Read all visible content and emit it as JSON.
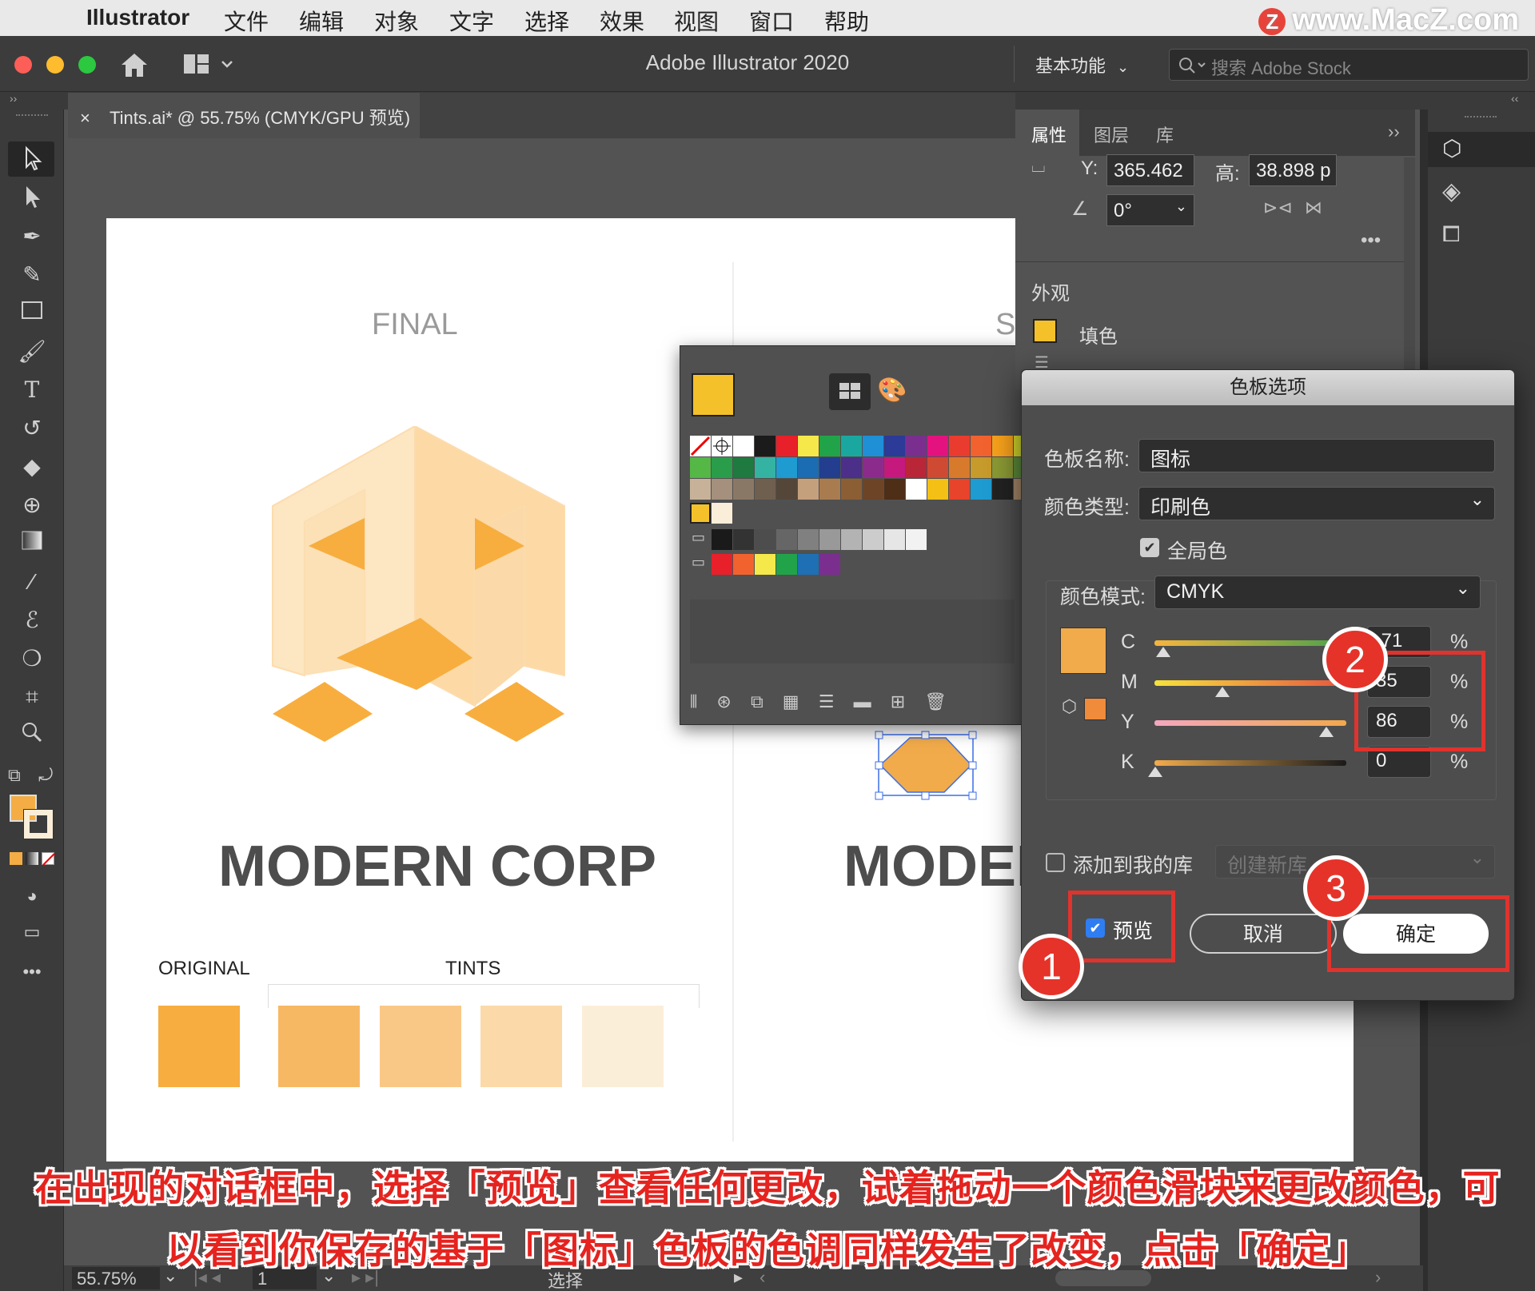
{
  "menubar": {
    "app": "Illustrator",
    "items": [
      "文件",
      "编辑",
      "对象",
      "文字",
      "选择",
      "效果",
      "视图",
      "窗口",
      "帮助"
    ],
    "watermark": "www.MacZ.com",
    "watermark_badge": "Z"
  },
  "titlebar": {
    "title": "Adobe Illustrator 2020",
    "workspace": "基本功能",
    "search_placeholder": "搜索 Adobe Stock"
  },
  "document_tab": {
    "close": "×",
    "label": "Tints.ai* @ 55.75% (CMYK/GPU 预览)"
  },
  "artboard": {
    "final_label": "FINAL",
    "second_label_partial": "ST",
    "company": "MODERN CORP",
    "company_partial": "MODEI",
    "original_label": "ORIGINAL",
    "tints_label": "TINTS"
  },
  "properties_panel": {
    "tabs": [
      "属性",
      "图层",
      "库"
    ],
    "y_label": "Y:",
    "y_value": "365.462",
    "h_label": "高:",
    "h_value": "38.898 p",
    "angle_value": "0°",
    "appearance_heading": "外观",
    "fill_label": "填色"
  },
  "swatch_options_dialog": {
    "title": "色板选项",
    "name_label": "色板名称:",
    "name_value": "图标",
    "type_label": "颜色类型:",
    "type_value": "印刷色",
    "global_label": "全局色",
    "mode_label": "颜色模式:",
    "mode_value": "CMYK",
    "channels": [
      {
        "label": "C",
        "value": ".71",
        "percent": "%"
      },
      {
        "label": "M",
        "value": "35",
        "percent": "%"
      },
      {
        "label": "Y",
        "value": "86",
        "percent": "%"
      },
      {
        "label": "K",
        "value": "0",
        "percent": "%"
      }
    ],
    "add_to_library_label": "添加到我的库",
    "new_library_placeholder": "创建新库...",
    "preview_label": "预览",
    "cancel_label": "取消",
    "ok_label": "确定"
  },
  "annotations": {
    "badge1": "1",
    "badge2": "2",
    "badge3": "3"
  },
  "status": {
    "zoom": "55.75%",
    "page": "1",
    "tool": "选择"
  },
  "caption": {
    "line1": "在出现的对话框中，选择「预览」查看任何更改，试着拖动一个颜色滑块来更改颜色，可",
    "line2": "以看到你保存的基于「图标」色板的色调同样发生了改变，点击「确定」"
  },
  "colors": {
    "accent_orange": "#f3ad44",
    "yellow_fill": "#f4c12a",
    "tint1": "#f7b864",
    "tint2": "#f9c886",
    "tint3": "#fbd9a8",
    "tint4": "#fbeed9",
    "annotation_red": "#e0332d"
  }
}
